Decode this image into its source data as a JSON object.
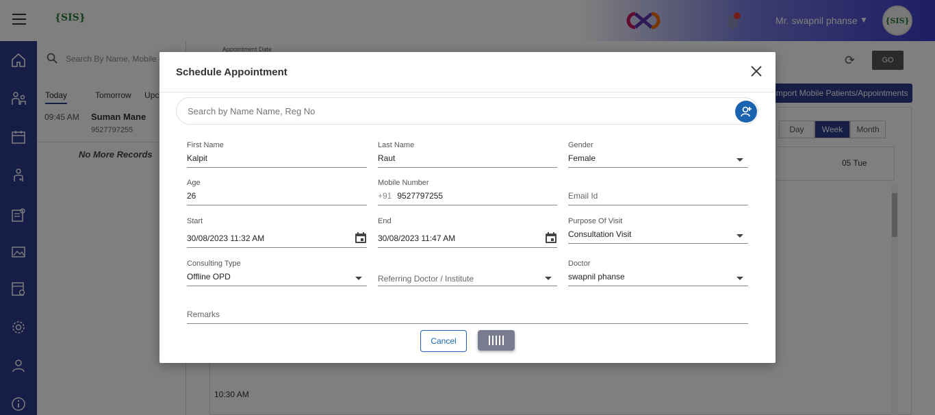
{
  "header": {
    "logo_text": "{SIS}",
    "user_name": "Mr. swapnil phanse",
    "avatar_text": "{SIS}"
  },
  "sidebar": {
    "items": [
      "home-icon",
      "doctor-patient-icon",
      "calendar-icon",
      "doctor-icon",
      "report-icon",
      "gallery-icon",
      "billing-icon",
      "settings-icon",
      "profile-icon",
      "info-icon"
    ]
  },
  "left_panel": {
    "search_placeholder": "Search By Name, Mobile #, ...",
    "tabs": [
      "Today",
      "Tomorrow",
      "Upco"
    ],
    "appointment": {
      "time": "09:45 AM",
      "name": "Suman Mane",
      "mobile": "9527797255"
    },
    "no_more": "No More Records"
  },
  "main": {
    "appointment_date_label": "Appointment Date",
    "go_label": "GO",
    "import_label": "Import Mobile Patients/Appointments",
    "views": [
      "Day",
      "Week",
      "Month"
    ],
    "active_view": "Week",
    "day_label": "05 Tue",
    "time_label": "10:30 AM"
  },
  "modal": {
    "title": "Schedule Appointment",
    "search_placeholder": "Search by Name Name, Reg No",
    "fields": {
      "first_name": {
        "label": "First Name",
        "value": "Kalpit"
      },
      "last_name": {
        "label": "Last Name",
        "value": "Raut"
      },
      "gender": {
        "label": "Gender",
        "value": "Female"
      },
      "age": {
        "label": "Age",
        "value": "26"
      },
      "mobile": {
        "label": "Mobile Number",
        "prefix": "+91",
        "value": "9527797255"
      },
      "email": {
        "placeholder": "Email Id"
      },
      "start": {
        "label": "Start",
        "value": "30/08/2023 11:32 AM"
      },
      "end": {
        "label": "End",
        "value": "30/08/2023 11:47 AM"
      },
      "purpose": {
        "label": "Purpose Of Visit",
        "value": "Consultation Visit"
      },
      "consulting_type": {
        "label": "Consulting Type",
        "value": "Offline OPD"
      },
      "referring": {
        "placeholder": "Referring Doctor / Institute"
      },
      "doctor": {
        "label": "Doctor",
        "value": "swapnil phanse"
      },
      "remarks": {
        "placeholder": "Remarks"
      }
    },
    "cancel_label": "Cancel"
  },
  "colors": {
    "sidebar": "#2d3a8c",
    "accent": "#1a63b0",
    "submit": "#7b7b8f"
  }
}
